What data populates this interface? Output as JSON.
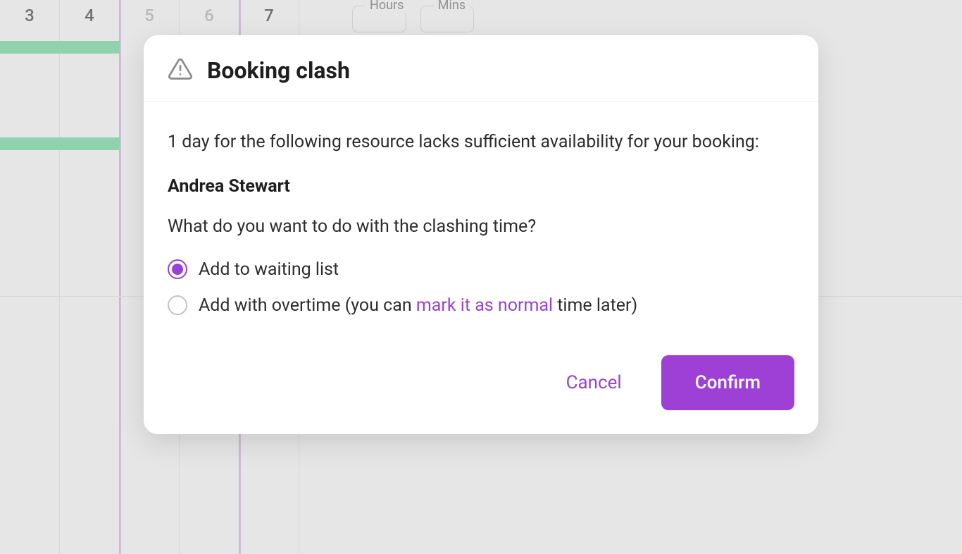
{
  "calendar": {
    "columns": [
      {
        "num": "3",
        "muted": false
      },
      {
        "num": "4",
        "muted": false
      },
      {
        "num": "5",
        "muted": true
      },
      {
        "num": "6",
        "muted": true
      },
      {
        "num": "7",
        "muted": false
      }
    ],
    "field_hours_label": "Hours",
    "field_mins_label": "Mins"
  },
  "modal": {
    "title": "Booking clash",
    "body_text": "1 day for the following resource lacks sufficient availability for your booking:",
    "resource_name": "Andrea Stewart",
    "prompt_text": "What do you want to do with the clashing time?",
    "options": {
      "waiting_list": {
        "label": "Add to waiting list",
        "selected": true
      },
      "overtime": {
        "label_prefix": "Add with overtime (you can ",
        "label_link": "mark it as normal",
        "label_suffix": " time later)",
        "selected": false
      }
    },
    "buttons": {
      "cancel": "Cancel",
      "confirm": "Confirm"
    }
  }
}
